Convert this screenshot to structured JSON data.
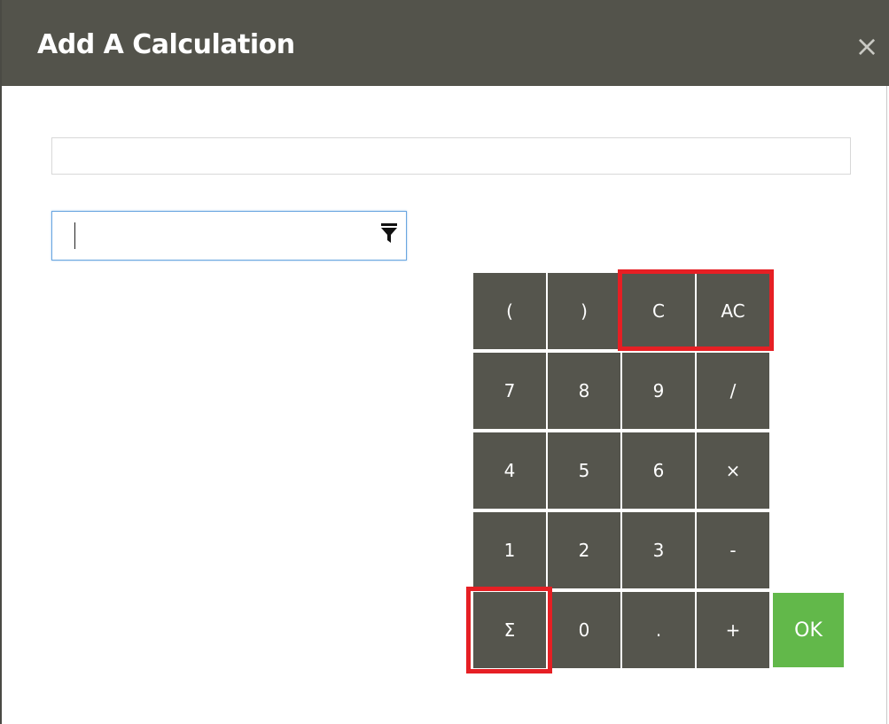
{
  "dialog": {
    "title": "Add A Calculation",
    "close_label": "×"
  },
  "name_input": {
    "value": "",
    "placeholder": ""
  },
  "field_select": {
    "value": "",
    "icon": "filter-icon"
  },
  "keypad": {
    "row1": [
      "(",
      ")",
      "C",
      "AC"
    ],
    "row2": [
      "7",
      "8",
      "9",
      "/"
    ],
    "row3": [
      "4",
      "5",
      "6",
      "×"
    ],
    "row4": [
      "1",
      "2",
      "3",
      "-"
    ],
    "row5": [
      "Σ",
      "0",
      ".",
      "+"
    ],
    "ok_label": "OK"
  },
  "colors": {
    "titlebar": "#53534b",
    "key": "#55554d",
    "ok": "#62b84a",
    "highlight": "#e61f24",
    "focus_border": "#6aa6e0"
  }
}
